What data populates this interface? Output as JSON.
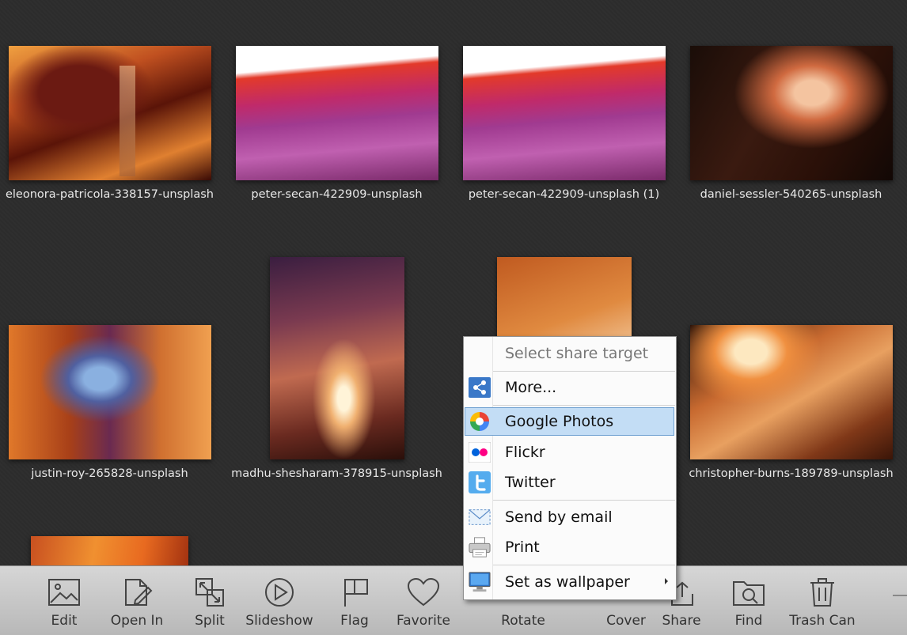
{
  "gallery": {
    "items": [
      {
        "caption": "eleonora-patricola-338157-unsplash"
      },
      {
        "caption": "peter-secan-422909-unsplash"
      },
      {
        "caption": "peter-secan-422909-unsplash (1)"
      },
      {
        "caption": "daniel-sessler-540265-unsplash"
      },
      {
        "caption": "justin-roy-265828-unsplash"
      },
      {
        "caption": "madhu-shesharam-378915-unsplash"
      },
      {
        "caption": ""
      },
      {
        "caption": "christopher-burns-189789-unsplash"
      },
      {
        "caption": ""
      }
    ]
  },
  "toolbar": {
    "items": [
      {
        "label": "Edit",
        "icon": "image-icon"
      },
      {
        "label": "Open In",
        "icon": "open-in-icon"
      },
      {
        "label": "Split",
        "icon": "split-icon"
      },
      {
        "label": "Slideshow",
        "icon": "play-icon"
      },
      {
        "label": "Flag",
        "icon": "flag-icon"
      },
      {
        "label": "Favorite",
        "icon": "heart-icon"
      },
      {
        "label": "Rotate",
        "icon": "rotate-icon"
      },
      {
        "label": "Cover",
        "icon": "cover-icon"
      },
      {
        "label": "Share",
        "icon": "share-icon"
      },
      {
        "label": "Find",
        "icon": "find-folder-icon"
      },
      {
        "label": "Trash Can",
        "icon": "trash-icon"
      }
    ]
  },
  "share_menu": {
    "header": "Select share target",
    "items": [
      {
        "label": "More...",
        "icon": "share-nodes-icon"
      },
      {
        "label": "Google Photos",
        "icon": "google-photos-icon",
        "selected": true
      },
      {
        "label": "Flickr",
        "icon": "flickr-icon"
      },
      {
        "label": "Twitter",
        "icon": "twitter-icon"
      },
      {
        "label": "Send by email",
        "icon": "envelope-icon"
      },
      {
        "label": "Print",
        "icon": "printer-icon"
      },
      {
        "label": "Set as wallpaper",
        "icon": "monitor-icon",
        "has_submenu": true
      }
    ]
  },
  "colors": {
    "background": "#2d2d2d",
    "selection": "#c3ddf5",
    "flickr_blue": "#0063dc",
    "flickr_pink": "#ff0084",
    "twitter_blue": "#55acee"
  }
}
